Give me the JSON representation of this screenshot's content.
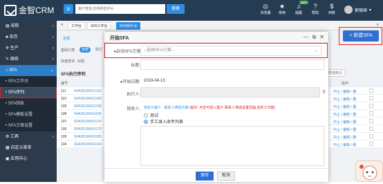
{
  "header": {
    "logo_text": "金智CRM",
    "menu_icon": "menu-icon",
    "search_placeholder": "客户查找,支持拼音字头",
    "search_button": "搜索",
    "icons": [
      {
        "label": "浏览器",
        "icon": "globe-icon"
      },
      {
        "label": "常用",
        "icon": "star-icon"
      },
      {
        "label": "提醒",
        "icon": "bell-icon",
        "badge": "1107"
      },
      {
        "label": "帮助",
        "icon": "help-icon"
      },
      {
        "label": "到账",
        "icon": "wallet-icon"
      }
    ],
    "user_name": "郭丽娅"
  },
  "sidebar": {
    "items": [
      {
        "label": "采购",
        "type": "group"
      },
      {
        "label": "库存",
        "type": "group"
      },
      {
        "label": "生产",
        "type": "group"
      },
      {
        "label": "维修",
        "type": "group"
      },
      {
        "label": "SFA",
        "type": "section"
      },
      {
        "label": "SFA工作台",
        "type": "sub"
      },
      {
        "label": "SFA序列",
        "type": "sub",
        "active": true
      },
      {
        "label": "SFA回执",
        "type": "sub"
      },
      {
        "label": "SFA模板设置",
        "type": "sub"
      },
      {
        "label": "SFA方案设置",
        "type": "sub"
      },
      {
        "label": "工具",
        "type": "group"
      },
      {
        "label": "自定义菜单",
        "type": "group"
      },
      {
        "label": "应用中心",
        "type": "group"
      }
    ]
  },
  "tabs": [
    {
      "label": "工作台"
    },
    {
      "label": "SFA工作台"
    },
    {
      "label": "SFA序列",
      "active": true
    }
  ],
  "list": {
    "filter_label": "全部",
    "filter_row_label": "基础分类:",
    "filter_chip": "全部",
    "filter_chip2": "执行",
    "search_row_label": "快速查询",
    "search_row_tag": "标题",
    "panel_title": "SFA执行序列",
    "header_id": "编号",
    "header_ops": "操作",
    "view_toggle": "所选执行",
    "new_button": "+ 新建SFA",
    "rows": [
      {
        "id": "111",
        "sn": "SFA20190413153"
      },
      {
        "id": "110",
        "sn": "SFA20190412160"
      },
      {
        "id": "109",
        "sn": "SFA20190412165"
      },
      {
        "id": "108",
        "sn": "SFA20190411094"
      },
      {
        "id": "107",
        "sn": "SFA20190410170"
      },
      {
        "id": "106",
        "sn": "SFA20190410170"
      },
      {
        "id": "105",
        "sn": "SFA20190410165"
      },
      {
        "id": "104",
        "sn": "SFA20190410164"
      }
    ],
    "ops_text": "中止 / 编辑 / 删"
  },
  "modal": {
    "title": "开始SFA",
    "scheme_label": "启动SFA方案:",
    "scheme_placeholder": "--选择SFA方案--",
    "title_label": "标题:",
    "date_label": "开始日期:",
    "date_value": "2019-04-13",
    "executor_label": "执行人:",
    "receiver_label": "接收人:",
    "receiver_hint_blue": "自定义客户 · 联系人筛选方案",
    "receiver_hint_red": "(提示: 点击可进入客户·联系人筛选设置页面,自定义方案)",
    "radio_test": "测试",
    "radio_manual": "手工录入收件列表",
    "ok": "保存",
    "cancel": "取消"
  },
  "colors": {
    "topbar": "#263c52",
    "sidebar": "#2d3a4b",
    "accent": "#2f8de4",
    "highlight": "#e02020"
  }
}
